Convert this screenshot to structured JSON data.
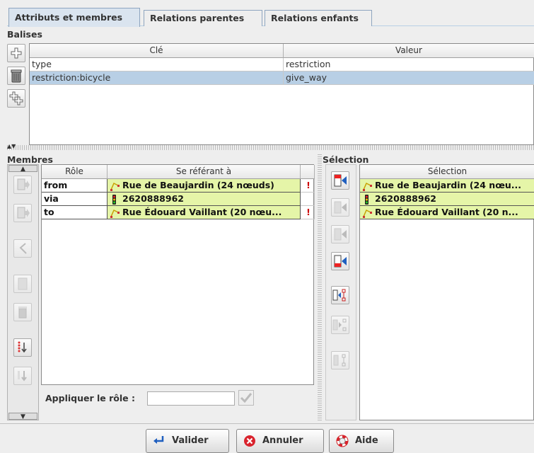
{
  "tabs": [
    {
      "label": "Attributs et membres",
      "active": true
    },
    {
      "label": "Relations parentes",
      "active": false
    },
    {
      "label": "Relations enfants",
      "active": false
    }
  ],
  "tags": {
    "title": "Balises",
    "columns": {
      "key": "Clé",
      "value": "Valeur"
    },
    "rows": [
      {
        "key": "type",
        "value": "restriction",
        "selected": false
      },
      {
        "key": "restriction:bicycle",
        "value": "give_way",
        "selected": true
      }
    ],
    "buttons": [
      "add-tag-icon",
      "delete-tag-icon",
      "paste-tags-icon"
    ]
  },
  "members": {
    "title": "Membres",
    "columns": {
      "role": "Rôle",
      "refers": "Se référant à"
    },
    "rows": [
      {
        "role": "from",
        "member": "Rue de Beaujardin (24 nœuds)",
        "type": "way",
        "incomplete": true
      },
      {
        "role": "via",
        "member": "2620888962",
        "type": "node",
        "incomplete": false
      },
      {
        "role": "to",
        "member": "Rue Édouard Vaillant (20 nœu...",
        "type": "way",
        "incomplete": true
      }
    ],
    "apply_role_label": "Appliquer le rôle :",
    "apply_role_value": ""
  },
  "selection": {
    "title": "Sélection",
    "column": "Sélection",
    "rows": [
      {
        "member": "Rue de Beaujardin (24 nœu...",
        "type": "way"
      },
      {
        "member": "2620888962",
        "type": "node"
      },
      {
        "member": "Rue Édouard Vaillant (20 n...",
        "type": "way"
      }
    ]
  },
  "buttons": {
    "ok": "Valider",
    "cancel": "Annuler",
    "help": "Aide"
  },
  "colors": {
    "member_bg": "#e5f5a8",
    "selected_row": "#b8cfe5",
    "tab_active": "#dae4ef"
  }
}
